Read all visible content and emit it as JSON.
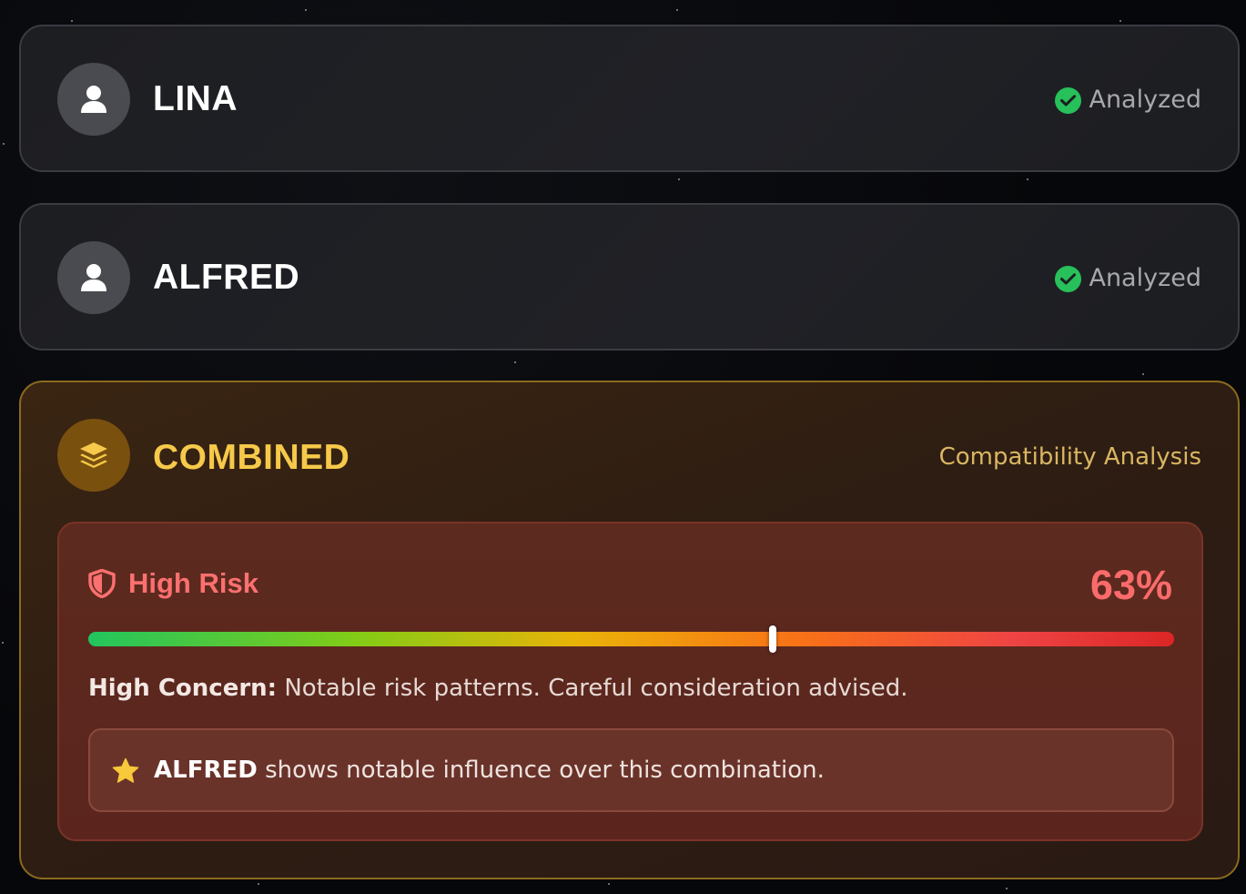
{
  "people": [
    {
      "name": "LINA",
      "status": "Analyzed"
    },
    {
      "name": "ALFRED",
      "status": "Analyzed"
    }
  ],
  "combined": {
    "title": "COMBINED",
    "subtitle": "Compatibility Analysis",
    "risk": {
      "label": "High Risk",
      "percent_text": "63%",
      "percent_value": 63,
      "concern_label": "High Concern:",
      "concern_text": " Notable risk patterns. Careful consideration advised.",
      "influence_name": "ALFRED",
      "influence_text": " shows notable influence over this combination."
    }
  },
  "icons": {
    "person": "user-icon",
    "status": "check-circle-icon",
    "combined": "layers-icon",
    "risk": "shield-icon",
    "influence": "star-icon"
  },
  "colors": {
    "accent_gold": "#f6c94a",
    "risk_red": "#fb6b6b",
    "status_green": "#27c05a"
  }
}
